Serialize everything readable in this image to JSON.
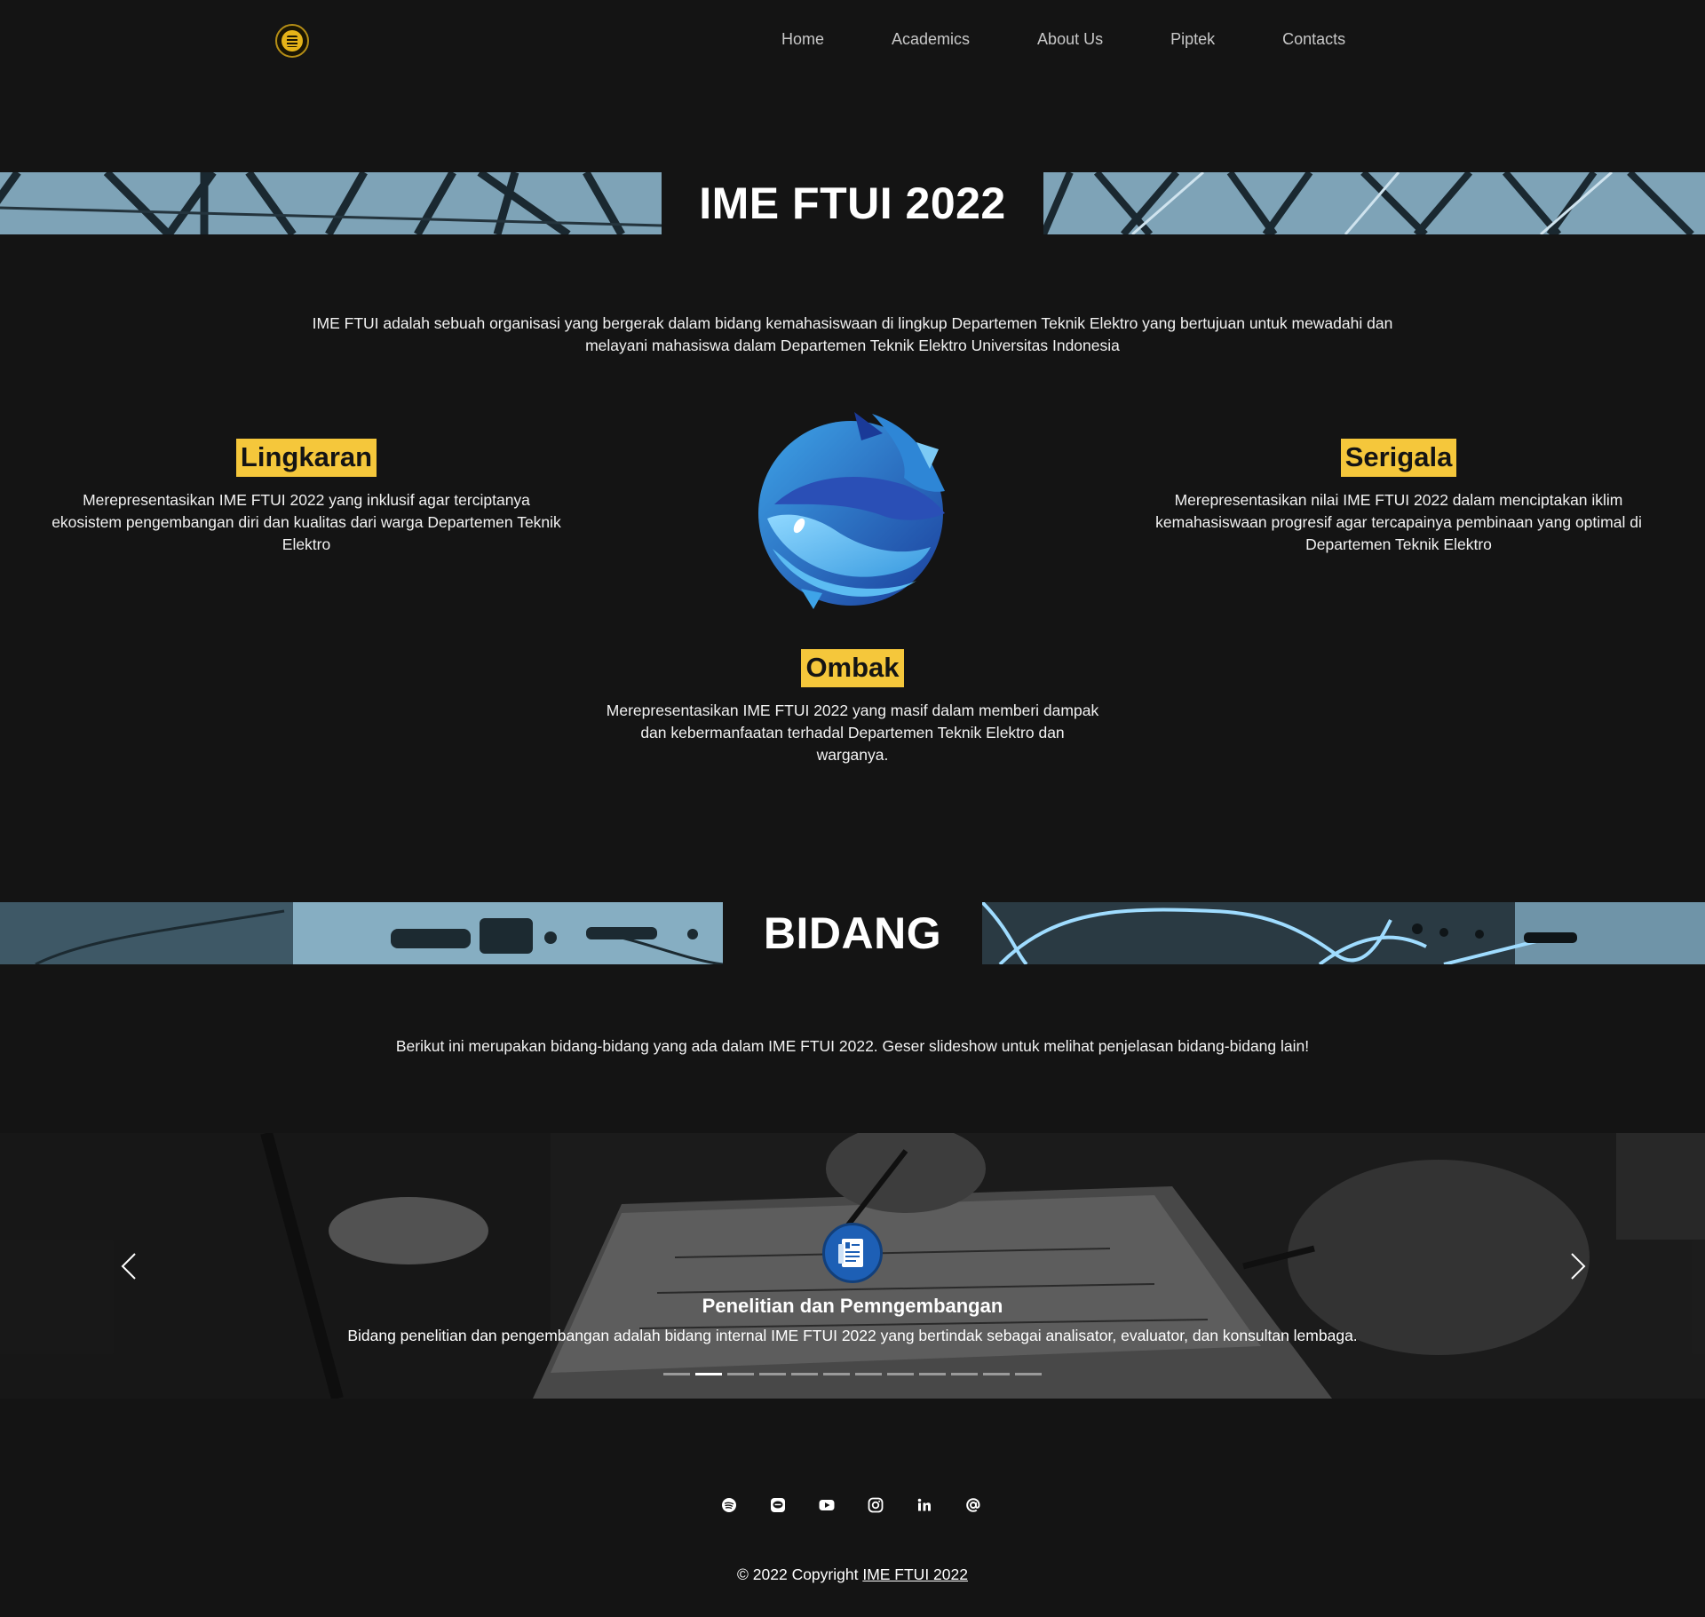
{
  "navbar": {
    "logo_icon": "ime-ftui-logo",
    "links": [
      "Home",
      "Academics",
      "About Us",
      "Piptek",
      "Contacts"
    ]
  },
  "hero": {
    "title": "IME FTUI 2022",
    "intro": "IME FTUI adalah sebuah organisasi yang bergerak dalam bidang kemahasiswaan di lingkup Departemen Teknik Elektro yang bertujuan untuk mewadahi dan melayani mahasiswa dalam Departemen Teknik Elektro Universitas Indonesia"
  },
  "philosophy": {
    "lingkaran": {
      "title": "Lingkaran",
      "text": "Merepresentasikan IME FTUI 2022 yang inklusif agar terciptanya ekosistem pengembangan diri dan kualitas dari warga Departemen Teknik Elektro"
    },
    "serigala": {
      "title": "Serigala",
      "text": "Merepresentasikan nilai IME FTUI 2022 dalam menciptakan iklim kemahasiswaan progresif agar tercapainya pembinaan yang optimal di Departemen Teknik Elektro"
    },
    "ombak": {
      "title": "Ombak",
      "text": "Merepresentasikan IME FTUI 2022 yang masif dalam memberi dampak dan kebermanfaatan terhadal Departemen Teknik Elektro dan warganya."
    },
    "emblem_icon": "wolf-wave-emblem"
  },
  "bidang": {
    "title": "BIDANG",
    "intro": "Berikut ini merupakan bidang-bidang yang ada dalam IME FTUI 2022. Geser slideshow untuk melihat penjelasan bidang-bidang lain!"
  },
  "slideshow": {
    "active_index": 1,
    "slide_count": 12,
    "current": {
      "icon": "document-report-icon",
      "title": "Penelitian dan Pemngembangan",
      "description": "Bidang penelitian dan pengembangan adalah bidang internal IME FTUI 2022 yang bertindak sebagai analisator, evaluator, dan konsultan lembaga."
    }
  },
  "footer": {
    "social_icons": [
      "spotify-icon",
      "line-icon",
      "youtube-icon",
      "instagram-icon",
      "linkedin-icon",
      "email-icon"
    ],
    "copyright_prefix": "© 2022 Copyright ",
    "copyright_link": "IME FTUI 2022"
  },
  "colors": {
    "background": "#141414",
    "accent_yellow": "#f5c73b",
    "banner_blue": "#6f94a8",
    "emblem_blue": "#1d5fb5"
  }
}
